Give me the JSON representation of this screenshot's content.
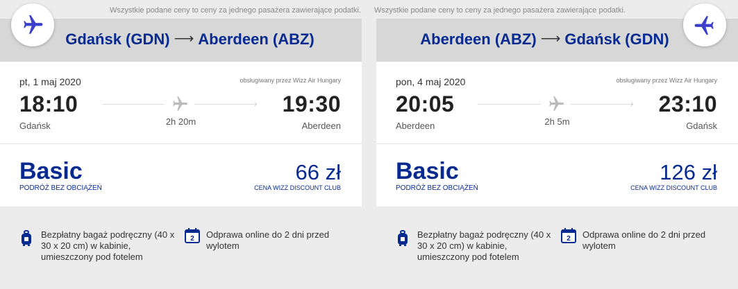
{
  "outbound": {
    "notice": "Wszystkie podane ceny to ceny za jednego pasażera zawierające podatki.",
    "origin": "Gdańsk (GDN)",
    "destination": "Aberdeen (ABZ)",
    "date": "pt, 1 maj 2020",
    "operator": "obsługiwany przez Wizz Air Hungary",
    "departure_time": "18:10",
    "arrival_time": "19:30",
    "departure_city": "Gdańsk",
    "arrival_city": "Aberdeen",
    "duration": "2h 20m",
    "fare_name": "Basic",
    "fare_subtitle": "PODRÓŻ BEZ OBCIĄŻEŃ",
    "price": "66 zł",
    "price_subtitle": "CENA WIZZ DISCOUNT CLUB",
    "feature_bag": "Bezpłatny bagaż podręczny (40 x 30 x 20 cm) w kabinie, umieszczony pod fotelem",
    "feature_checkin": "Odprawa online do 2 dni przed wylotem",
    "calendar_number": "2"
  },
  "return": {
    "notice": "Wszystkie podane ceny to ceny za jednego pasażera zawierające podatki.",
    "origin": "Aberdeen (ABZ)",
    "destination": "Gdańsk (GDN)",
    "date": "pon, 4 maj 2020",
    "operator": "obsługiwany przez Wizz Air Hungary",
    "departure_time": "20:05",
    "arrival_time": "23:10",
    "departure_city": "Aberdeen",
    "arrival_city": "Gdańsk",
    "duration": "2h 5m",
    "fare_name": "Basic",
    "fare_subtitle": "PODRÓŻ BEZ OBCIĄŻEŃ",
    "price": "126 zł",
    "price_subtitle": "CENA WIZZ DISCOUNT CLUB",
    "feature_bag": "Bezpłatny bagaż podręczny (40 x 30 x 20 cm) w kabinie, umieszczony pod fotelem",
    "feature_checkin": "Odprawa online do 2 dni przed wylotem",
    "calendar_number": "2"
  },
  "icons": {
    "plane": "plane-icon",
    "bag": "cabin-bag-icon",
    "calendar": "calendar-icon"
  },
  "colors": {
    "brand_blue": "#062a90",
    "circle_plane": "#3b3fc9",
    "band_gray": "#d7d7d7",
    "page_gray": "#ececec"
  }
}
